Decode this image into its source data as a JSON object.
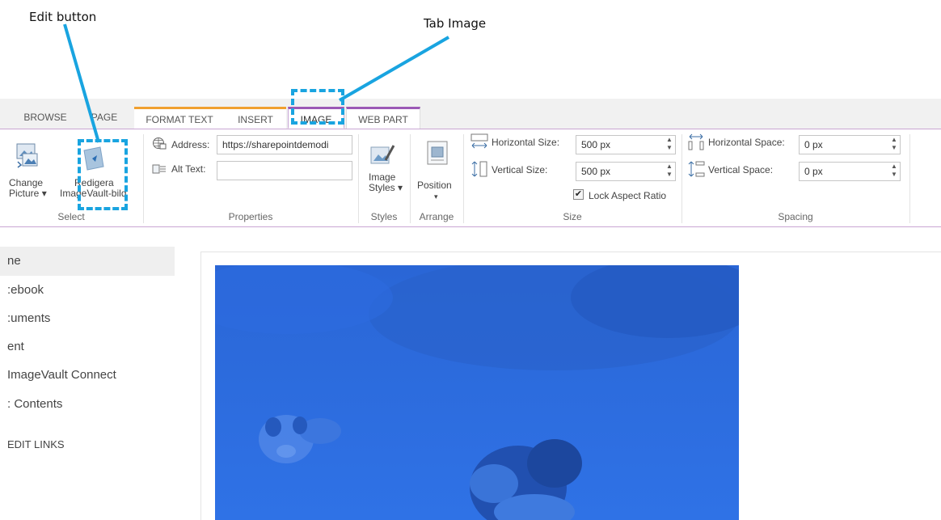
{
  "annotations": {
    "edit_button_label": "Edit button",
    "tab_image_label": "Tab Image"
  },
  "ribbon": {
    "tabs": [
      {
        "label": "BROWSE"
      },
      {
        "label": "PAGE"
      },
      {
        "label": "FORMAT TEXT"
      },
      {
        "label": "INSERT"
      },
      {
        "label": "IMAGE"
      },
      {
        "label": "WEB PART"
      }
    ],
    "select": {
      "change_picture_line1": "Change",
      "change_picture_line2": "Picture",
      "redigera_line1": "Redigera",
      "redigera_line2": "ImageVault-bild",
      "group_label": "Select"
    },
    "properties": {
      "address_label": "Address:",
      "address_value": "https://sharepointdemodi",
      "alt_label": "Alt Text:",
      "alt_value": "",
      "group_label": "Properties"
    },
    "styles": {
      "button_line1": "Image",
      "button_line2": "Styles",
      "group_label": "Styles"
    },
    "arrange": {
      "button_label": "Position",
      "group_label": "Arrange"
    },
    "size": {
      "horizontal_label": "Horizontal Size:",
      "horizontal_value": "500 px",
      "vertical_label": "Vertical Size:",
      "vertical_value": "500 px",
      "lock_label": "Lock Aspect Ratio",
      "lock_checked": true,
      "group_label": "Size"
    },
    "spacing": {
      "horizontal_label": "Horizontal Space:",
      "horizontal_value": "0 px",
      "vertical_label": "Vertical Space:",
      "vertical_value": "0 px",
      "group_label": "Spacing"
    }
  },
  "left_nav": {
    "items": [
      {
        "label": "ne"
      },
      {
        "label": ":ebook"
      },
      {
        "label": ":uments"
      },
      {
        "label": "ent"
      },
      {
        "label": "ImageVault Connect"
      },
      {
        "label": ": Contents"
      }
    ],
    "edit_links": "EDIT LINKS"
  },
  "colors": {
    "annotation": "#19a4e0",
    "image_tab": "#9b59b6",
    "format_tab": "#f0a030",
    "photo_tint": "#2d6fe3"
  }
}
